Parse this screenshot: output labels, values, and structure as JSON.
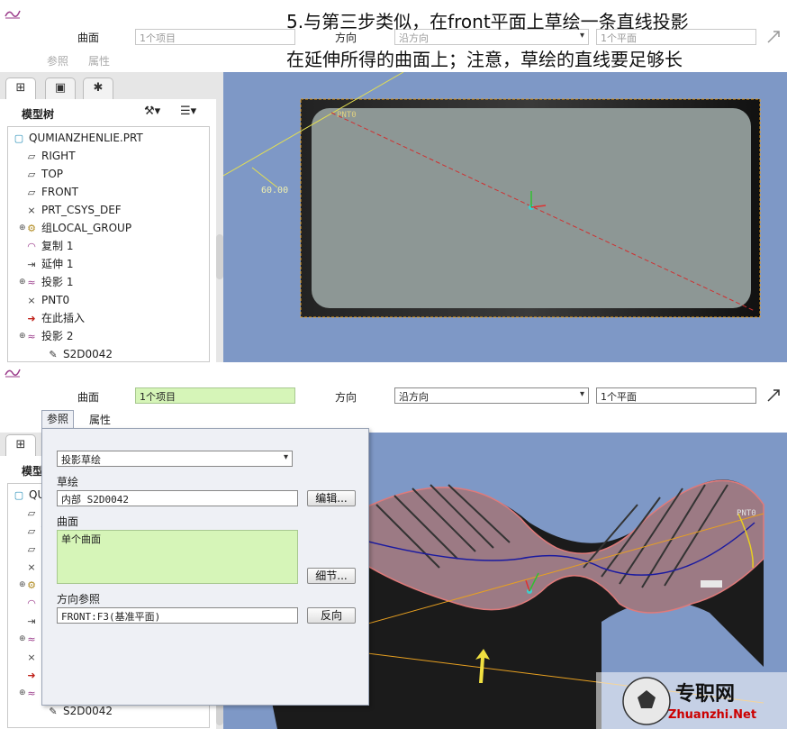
{
  "caption": {
    "line1": "5.与第三步类似，在front平面上草绘一条直线投影",
    "line2": "在延伸所得的曲面上；注意，草绘的直线要足够长"
  },
  "dashboard": {
    "surface_label": "曲面",
    "surface_value": "1个项目",
    "direction_label": "方向",
    "direction_value": "沿方向",
    "direction_ref_value": "1个平面",
    "tab_refs": "参照",
    "tab_props": "属性"
  },
  "model_tree": {
    "title": "模型树",
    "items": [
      {
        "label": "QUMIANZHENLIE.PRT",
        "icon": "part-icon"
      },
      {
        "label": "RIGHT",
        "icon": "datum-plane-icon"
      },
      {
        "label": "TOP",
        "icon": "datum-plane-icon"
      },
      {
        "label": "FRONT",
        "icon": "datum-plane-icon"
      },
      {
        "label": "PRT_CSYS_DEF",
        "icon": "csys-icon"
      },
      {
        "label": "组LOCAL_GROUP",
        "icon": "group-icon"
      },
      {
        "label": "复制 1",
        "icon": "copy-surface-icon"
      },
      {
        "label": "延伸 1",
        "icon": "extend-icon"
      },
      {
        "label": "投影 1",
        "icon": "project-icon"
      },
      {
        "label": "PNT0",
        "icon": "datum-point-icon"
      },
      {
        "label": "在此插入",
        "icon": "insert-arrow-icon"
      },
      {
        "label": "投影 2",
        "icon": "project-icon"
      },
      {
        "label": "S2D0042",
        "icon": "sketch-icon"
      }
    ]
  },
  "viewport_top": {
    "dimension": "60.00",
    "point_label": "PNT0"
  },
  "viewport_bottom": {
    "point_label": "PNT0"
  },
  "refs_panel": {
    "type_value": "投影草绘",
    "sketch_label": "草绘",
    "sketch_value": "内部 S2D0042",
    "edit_button": "编辑...",
    "surface_label": "曲面",
    "surface_value": "单个曲面",
    "details_button": "细节...",
    "dir_ref_label": "方向参照",
    "dir_ref_value": "FRONT:F3(基准平面)",
    "flip_button": "反向"
  },
  "watermark": {
    "name": "专职网",
    "url": "Zhuanzhi.Net"
  },
  "colors": {
    "viewport_bg": "#7e98c6",
    "surface_edge": "#e07a7a",
    "sketch_line": "#1a1aa0",
    "accent_orange": "#e8a020"
  }
}
